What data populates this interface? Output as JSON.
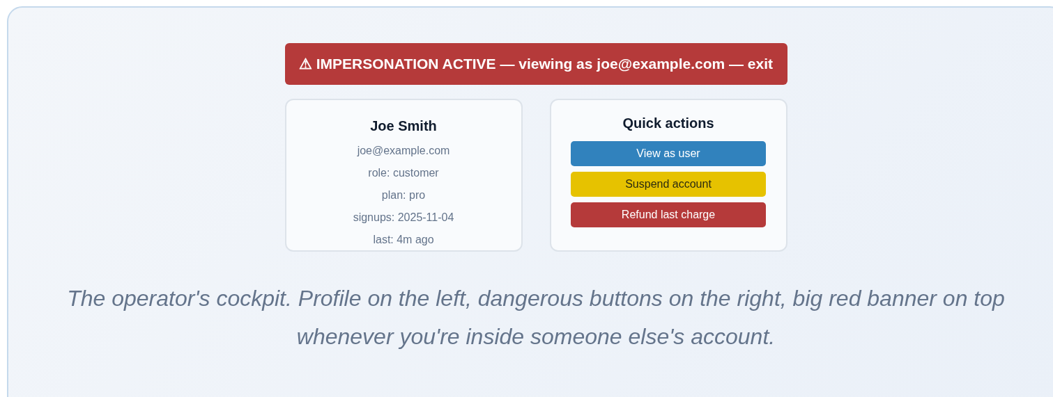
{
  "banner": {
    "text": "⚠ IMPERSONATION ACTIVE — viewing as joe@example.com — exit"
  },
  "profile": {
    "name": "Joe Smith",
    "lines": [
      "joe@example.com",
      "role: customer",
      "plan: pro",
      "signups: 2025-11-04",
      "last: 4m ago"
    ]
  },
  "quick_actions": {
    "title": "Quick actions",
    "buttons": [
      {
        "label": "View as user",
        "kind": "primary"
      },
      {
        "label": "Suspend account",
        "kind": "warning"
      },
      {
        "label": "Refund last charge",
        "kind": "danger"
      }
    ]
  },
  "caption": "The operator's cockpit. Profile on the left, dangerous buttons on the right, big red banner on top whenever you're inside someone else's account."
}
